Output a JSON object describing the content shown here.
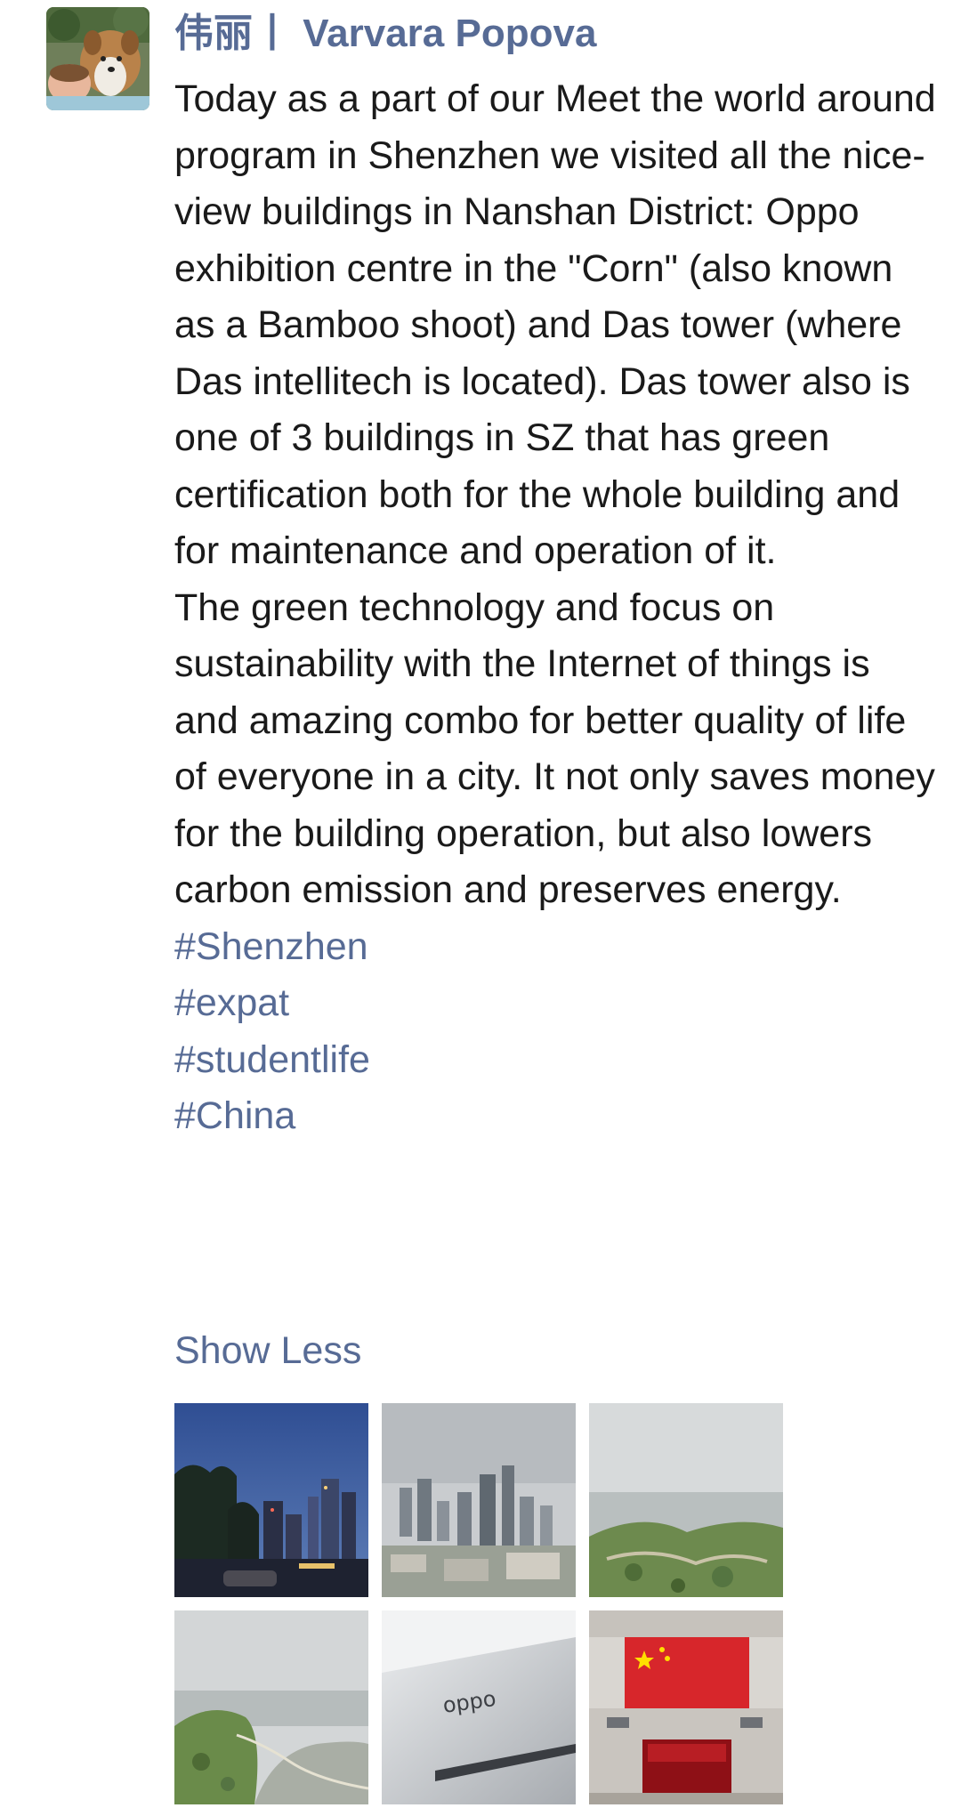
{
  "post": {
    "author": "伟丽丨 Varvara Popova",
    "paragraphs": [
      "Today as a part of our Meet the world around program in Shenzhen we visited all the nice-view buildings in Nanshan District: Oppo exhibition centre in the \"Corn\" (also known as a Bamboo shoot)  and Das tower (where Das intellitech is located). Das tower also is one of 3 buildings in SZ that has green certification both for the whole building and for maintenance and operation of it.",
      "The green technology and focus on sustainability with the Internet of things is and amazing combo for better quality of life of everyone in a city. It not only saves money for the building operation, but also lowers carbon emission and preserves energy."
    ],
    "hashtags": [
      "#Shenzhen",
      "#expat",
      "#studentlife",
      "#China"
    ],
    "show_less": "Show Less",
    "photo_logo_text": "oppo"
  },
  "colors": {
    "link": "#576b95",
    "text": "#1a1a1a",
    "background": "#ffffff"
  },
  "icons": {
    "avatar": "avatar-dog-photo"
  }
}
